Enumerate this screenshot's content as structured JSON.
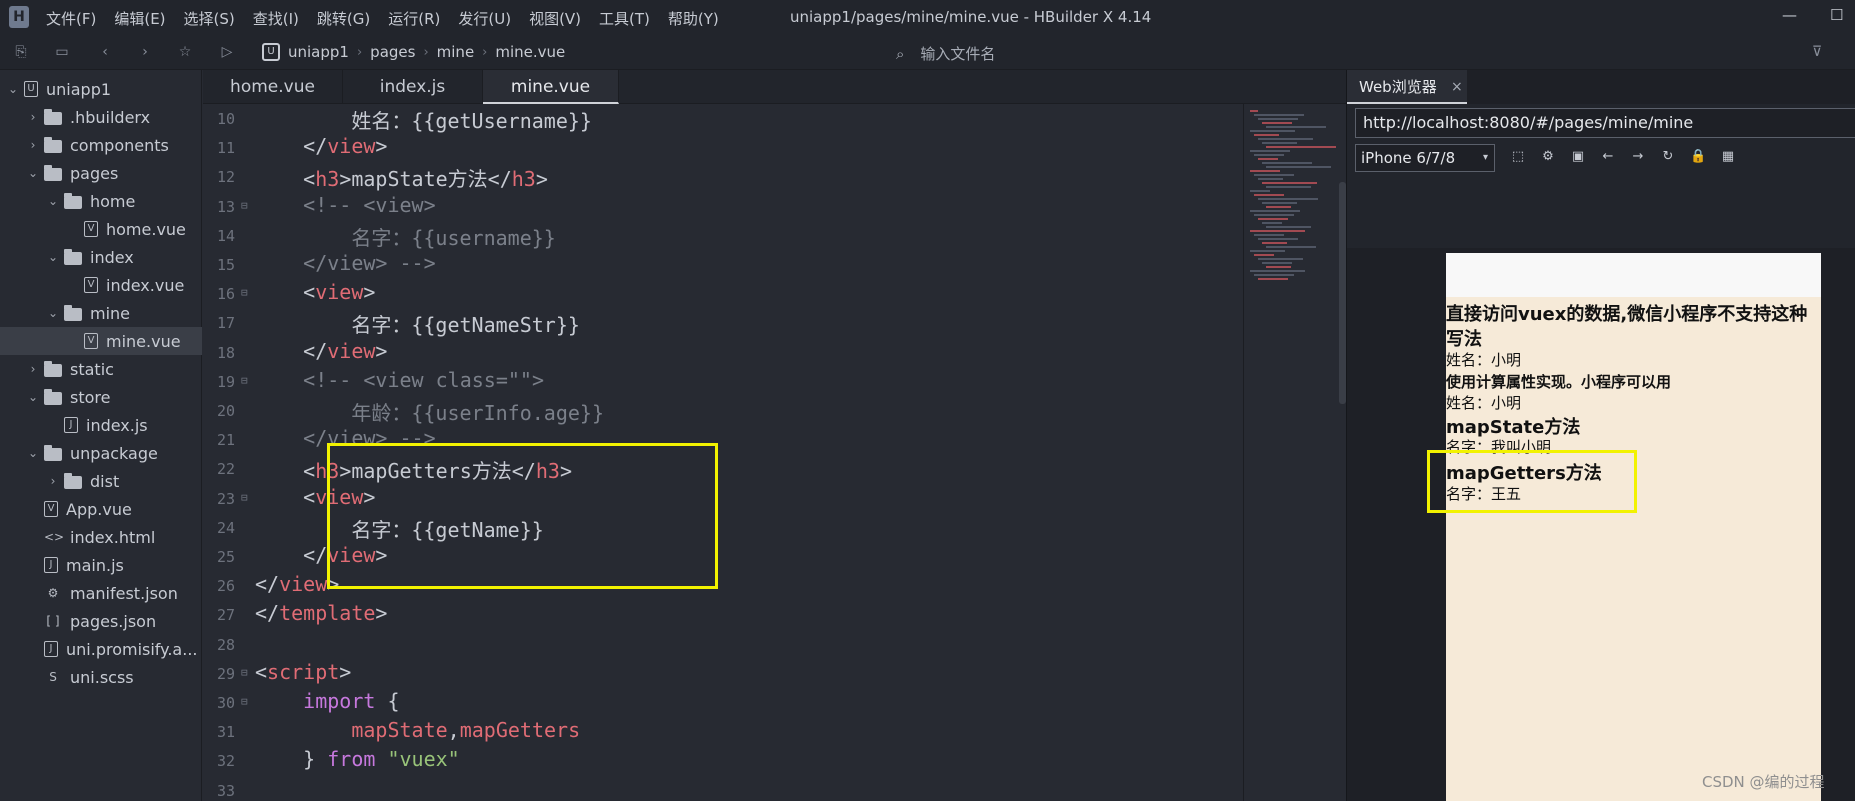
{
  "window": {
    "title": "uniapp1/pages/mine/mine.vue - HBuilder X 4.14",
    "logo": "H",
    "menu": [
      "文件(F)",
      "编辑(E)",
      "选择(S)",
      "查找(I)",
      "跳转(G)",
      "运行(R)",
      "发行(U)",
      "视图(V)",
      "工具(T)",
      "帮助(Y)"
    ],
    "min_glyph": "—",
    "max_glyph": "☐"
  },
  "toolbar": {
    "crumb_logo": "U",
    "breadcrumbs": [
      "uniapp1",
      "pages",
      "mine",
      "mine.vue"
    ],
    "file_search_placeholder": "输入文件名"
  },
  "sidebar": {
    "items": [
      {
        "label": "uniapp1",
        "chev": "⌄",
        "icon": "U"
      },
      {
        "label": ".hbuilderx",
        "chev": "›",
        "icon": "folder"
      },
      {
        "label": "components",
        "chev": "›",
        "icon": "folder"
      },
      {
        "label": "pages",
        "chev": "⌄",
        "icon": "folder"
      },
      {
        "label": "home",
        "chev": "⌄",
        "icon": "folder"
      },
      {
        "label": "home.vue",
        "chev": "",
        "icon": "V"
      },
      {
        "label": "index",
        "chev": "⌄",
        "icon": "folder"
      },
      {
        "label": "index.vue",
        "chev": "",
        "icon": "V"
      },
      {
        "label": "mine",
        "chev": "⌄",
        "icon": "folder"
      },
      {
        "label": "mine.vue",
        "chev": "",
        "icon": "V"
      },
      {
        "label": "static",
        "chev": "›",
        "icon": "folder"
      },
      {
        "label": "store",
        "chev": "⌄",
        "icon": "folder"
      },
      {
        "label": "index.js",
        "chev": "",
        "icon": "J"
      },
      {
        "label": "unpackage",
        "chev": "⌄",
        "icon": "folder"
      },
      {
        "label": "dist",
        "chev": "›",
        "icon": "folder"
      },
      {
        "label": "App.vue",
        "chev": "",
        "icon": "V"
      },
      {
        "label": "index.html",
        "chev": "",
        "icon": "<>"
      },
      {
        "label": "main.js",
        "chev": "",
        "icon": "J"
      },
      {
        "label": "manifest.json",
        "chev": "",
        "icon": "⚙"
      },
      {
        "label": "pages.json",
        "chev": "",
        "icon": "[ ]"
      },
      {
        "label": "uni.promisify.a...",
        "chev": "",
        "icon": "J"
      },
      {
        "label": "uni.scss",
        "chev": "",
        "icon": "S"
      }
    ]
  },
  "tabs": [
    "home.vue",
    "index.js",
    "mine.vue"
  ],
  "editor": {
    "lines": [
      {
        "n": "10",
        "fold": "",
        "segs": [
          [
            "",
            "        姓名："
          ],
          [
            "",
            "{{getUsername}}"
          ]
        ]
      },
      {
        "n": "11",
        "fold": "",
        "segs": [
          [
            "",
            "    </"
          ],
          [
            "tag",
            "view"
          ],
          [
            "",
            ">"
          ]
        ]
      },
      {
        "n": "12",
        "fold": "",
        "segs": [
          [
            "",
            "    <"
          ],
          [
            "tag",
            "h3"
          ],
          [
            "",
            ">mapState方法</"
          ],
          [
            "tag",
            "h3"
          ],
          [
            "",
            ">"
          ]
        ]
      },
      {
        "n": "13",
        "fold": "⊟",
        "segs": [
          [
            "comment",
            "    <!-- <view>"
          ]
        ]
      },
      {
        "n": "14",
        "fold": "",
        "segs": [
          [
            "comment",
            "        名字：{{username}}"
          ]
        ]
      },
      {
        "n": "15",
        "fold": "",
        "segs": [
          [
            "comment",
            "    </view> -->"
          ]
        ]
      },
      {
        "n": "16",
        "fold": "⊟",
        "segs": [
          [
            "",
            "    <"
          ],
          [
            "tag",
            "view"
          ],
          [
            "",
            ">"
          ]
        ]
      },
      {
        "n": "17",
        "fold": "",
        "segs": [
          [
            "",
            "        名字："
          ],
          [
            "",
            "{{getNameStr}}"
          ]
        ]
      },
      {
        "n": "18",
        "fold": "",
        "segs": [
          [
            "",
            "    </"
          ],
          [
            "tag",
            "view"
          ],
          [
            "",
            ">"
          ]
        ]
      },
      {
        "n": "19",
        "fold": "⊟",
        "segs": [
          [
            "comment",
            "    <!-- <view class=\"\">"
          ]
        ]
      },
      {
        "n": "20",
        "fold": "",
        "segs": [
          [
            "comment",
            "        年龄：{{userInfo.age}}"
          ]
        ]
      },
      {
        "n": "21",
        "fold": "",
        "segs": [
          [
            "comment",
            "    </view> -->"
          ]
        ]
      },
      {
        "n": "22",
        "fold": "",
        "segs": [
          [
            "",
            "    <"
          ],
          [
            "tag",
            "h3"
          ],
          [
            "",
            ">mapGetters方法</"
          ],
          [
            "tag",
            "h3"
          ],
          [
            "",
            ">"
          ]
        ]
      },
      {
        "n": "23",
        "fold": "⊟",
        "segs": [
          [
            "",
            "    <"
          ],
          [
            "tag",
            "view"
          ],
          [
            "",
            ">"
          ]
        ]
      },
      {
        "n": "24",
        "fold": "",
        "segs": [
          [
            "",
            "        名字："
          ],
          [
            "",
            "{{getName}}"
          ]
        ]
      },
      {
        "n": "25",
        "fold": "",
        "segs": [
          [
            "",
            "    </"
          ],
          [
            "tag",
            "view"
          ],
          [
            "",
            ">"
          ]
        ]
      },
      {
        "n": "26",
        "fold": "",
        "segs": [
          [
            "",
            "</"
          ],
          [
            "tag",
            "view"
          ],
          [
            "",
            ">"
          ]
        ]
      },
      {
        "n": "27",
        "fold": "",
        "segs": [
          [
            "",
            "</"
          ],
          [
            "tag",
            "template"
          ],
          [
            "",
            ">"
          ]
        ]
      },
      {
        "n": "28",
        "fold": "",
        "segs": [
          [
            "",
            ""
          ]
        ]
      },
      {
        "n": "29",
        "fold": "⊟",
        "segs": [
          [
            "",
            "<"
          ],
          [
            "tag",
            "script"
          ],
          [
            "",
            ">"
          ]
        ]
      },
      {
        "n": "30",
        "fold": "⊟",
        "segs": [
          [
            "",
            "    "
          ],
          [
            "kw",
            "import"
          ],
          [
            "",
            " {"
          ]
        ]
      },
      {
        "n": "31",
        "fold": "",
        "segs": [
          [
            "",
            "        "
          ],
          [
            "tag",
            "mapState"
          ],
          [
            "",
            ","
          ],
          [
            "tag",
            "mapGetters"
          ]
        ]
      },
      {
        "n": "32",
        "fold": "",
        "segs": [
          [
            "",
            "    } "
          ],
          [
            "kw",
            "from"
          ],
          [
            "",
            " "
          ],
          [
            "str",
            "\"vuex\""
          ]
        ]
      },
      {
        "n": "33",
        "fold": "",
        "segs": [
          [
            "",
            ""
          ]
        ]
      }
    ],
    "indents": [
      "        ",
      "    ",
      "    ",
      "    ",
      "        ",
      "    ",
      "    ",
      "        ",
      "    ",
      "    ",
      "        ",
      "    ",
      "    ",
      "    ",
      "        ",
      "    ",
      "",
      "",
      "",
      "",
      "",
      "",
      "",
      ""
    ]
  },
  "browser": {
    "tab_label": "Web浏览器",
    "close_glyph": "×",
    "url": "http://localhost:8080/#/pages/mine/mine",
    "device": "iPhone 6/7/8",
    "device_dd": "▾",
    "icons": [
      "⬚",
      "⚙",
      "▣",
      "←",
      "→",
      "↻",
      "🔒",
      "▦"
    ],
    "page": [
      {
        "text": "直接访问vuex的数据,微信小程序不支持这种",
        "kind": "h3"
      },
      {
        "text": "写法",
        "kind": "h3"
      },
      {
        "text": "姓名：小明",
        "kind": "p"
      },
      {
        "text": "使用计算属性实现。小程序可以用",
        "kind": "h4"
      },
      {
        "text": "姓名：小明",
        "kind": "p"
      },
      {
        "text": "mapState方法",
        "kind": "h3"
      },
      {
        "text": "名字：我叫小明",
        "kind": "p"
      },
      {
        "text": "mapGetters方法",
        "kind": "h3"
      },
      {
        "text": "名字：王五",
        "kind": "p"
      }
    ]
  },
  "watermark": "CSDN @编的过程",
  "colors": {
    "accent_highlight": "#f2f200",
    "tag": "#e06c75",
    "keyword": "#c678dd",
    "string": "#98c379"
  }
}
